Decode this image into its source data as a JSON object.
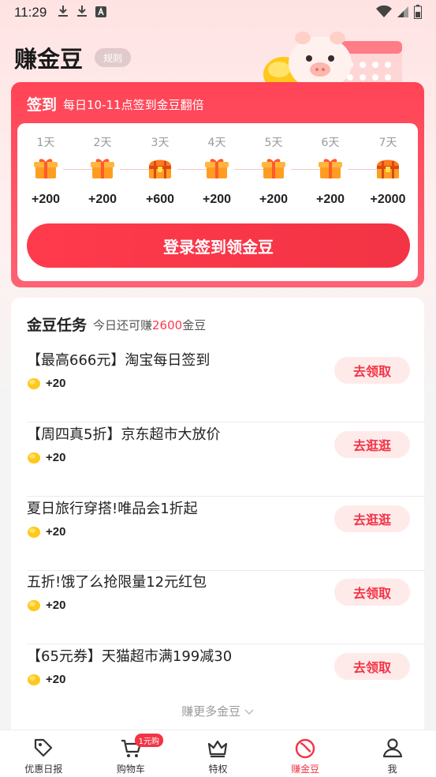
{
  "status_bar": {
    "time": "11:29",
    "icons": [
      "download-icon",
      "download-icon",
      "a-icon",
      "wifi-icon",
      "signal-icon",
      "battery-icon"
    ]
  },
  "header": {
    "title": "赚金豆",
    "rules_label": "规则"
  },
  "checkin": {
    "title": "签到",
    "subtitle": "每日10-11点签到金豆翻倍",
    "days": [
      {
        "label": "1天",
        "value": "+200",
        "icon": "gift-icon"
      },
      {
        "label": "2天",
        "value": "+200",
        "icon": "gift-icon"
      },
      {
        "label": "3天",
        "value": "+600",
        "icon": "treasure-chest-icon"
      },
      {
        "label": "4天",
        "value": "+200",
        "icon": "gift-icon"
      },
      {
        "label": "5天",
        "value": "+200",
        "icon": "gift-icon"
      },
      {
        "label": "6天",
        "value": "+200",
        "icon": "gift-icon"
      },
      {
        "label": "7天",
        "value": "+2000",
        "icon": "treasure-chest-icon"
      }
    ],
    "button_label": "登录签到领金豆"
  },
  "tasks": {
    "title": "金豆任务",
    "sub_prefix": "今日还可赚",
    "sub_amount": "2600",
    "sub_suffix": "金豆",
    "items": [
      {
        "title": "【最高666元】淘宝每日签到",
        "reward": "+20",
        "button": "去领取"
      },
      {
        "title": "【周四真5折】京东超市大放价",
        "reward": "+20",
        "button": "去逛逛"
      },
      {
        "title": "夏日旅行穿搭!唯品会1折起",
        "reward": "+20",
        "button": "去逛逛"
      },
      {
        "title": "五折!饿了么抢限量12元红包",
        "reward": "+20",
        "button": "去领取"
      },
      {
        "title": "【65元券】天猫超市满199减30",
        "reward": "+20",
        "button": "去领取"
      }
    ],
    "more_label": "赚更多金豆"
  },
  "bottom_nav": {
    "items": [
      {
        "label": "优惠日报",
        "icon": "tag-icon"
      },
      {
        "label": "购物车",
        "icon": "cart-icon",
        "badge": "1元购"
      },
      {
        "label": "特权",
        "icon": "crown-icon"
      },
      {
        "label": "赚金豆",
        "icon": "bean-icon",
        "active": true
      },
      {
        "label": "我",
        "icon": "user-icon"
      }
    ]
  },
  "colors": {
    "accent": "#f23445",
    "checkin_bg": "#ff4456",
    "button_light": "#ffeaea"
  }
}
